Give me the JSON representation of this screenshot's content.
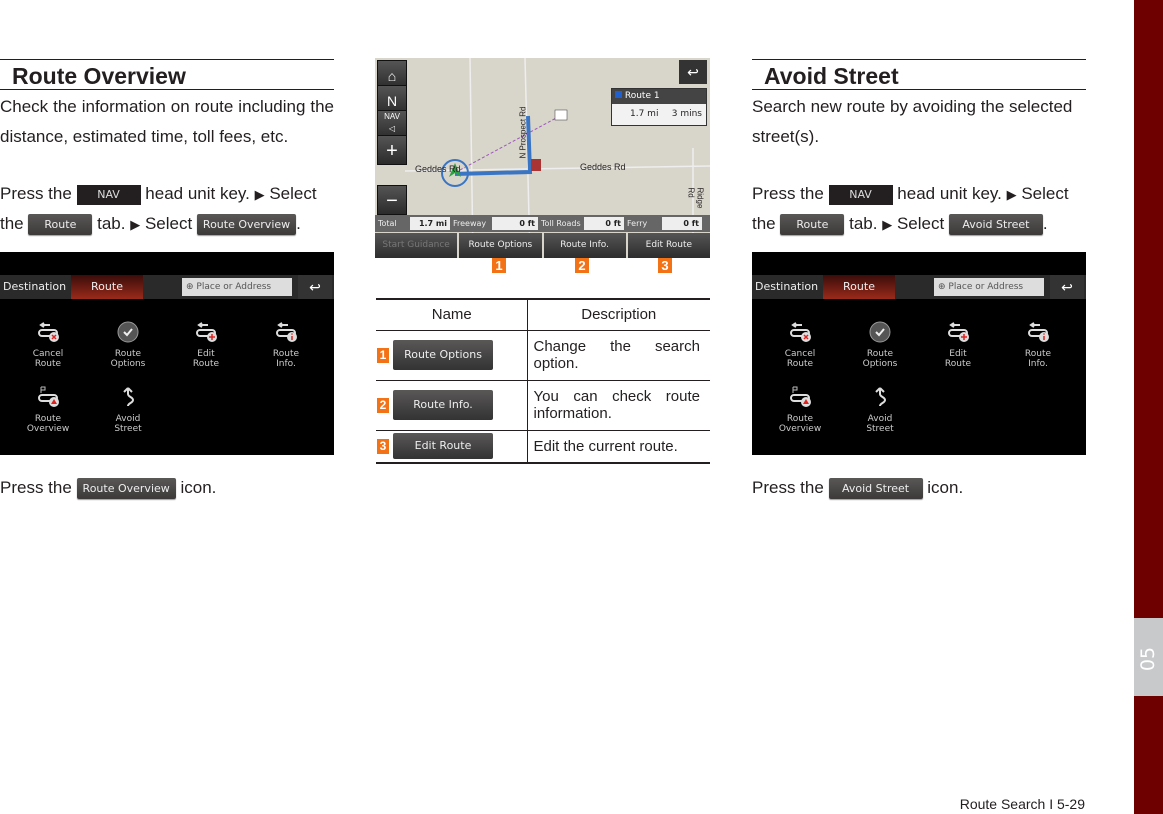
{
  "left": {
    "title": "Route Overview",
    "description": "Check the information on route including the distance, estimated time, toll fees, etc.",
    "step1_a": "Press the",
    "nav_key": "NAV",
    "step1_b": "head unit key.",
    "arrow": "▶",
    "step1_c": "Select",
    "step2_a": "the",
    "route_tab": "Route",
    "step2_b": "tab.",
    "step2_c": "Select",
    "select_button": "Route Overview",
    "press_a": "Press the",
    "press_button": "Route Overview",
    "press_b": "icon."
  },
  "right": {
    "title": "Avoid Street",
    "description": "Search new route by avoiding the selected street(s).",
    "step1_a": "Press the",
    "nav_key": "NAV",
    "step1_b": "head unit key.",
    "arrow": "▶",
    "step1_c": "Select",
    "step2_a": "the",
    "route_tab": "Route",
    "step2_b": "tab.",
    "step2_c": "Select",
    "select_button": "Avoid Street",
    "press_a": "Press the",
    "press_button": "Avoid Street",
    "press_b": "icon."
  },
  "headunit": {
    "tab_destination": "Destination",
    "tab_route": "Route",
    "search_placeholder": "Place or Address",
    "back": "↩",
    "items": [
      {
        "line1": "Cancel",
        "line2": "Route",
        "icon": "cancel-route-icon"
      },
      {
        "line1": "Route",
        "line2": "Options",
        "icon": "route-options-icon"
      },
      {
        "line1": "Edit",
        "line2": "Route",
        "icon": "edit-route-icon"
      },
      {
        "line1": "Route",
        "line2": "Info.",
        "icon": "route-info-icon"
      },
      {
        "line1": "Route",
        "line2": "Overview",
        "icon": "route-overview-icon"
      },
      {
        "line1": "Avoid",
        "line2": "Street",
        "icon": "avoid-street-icon"
      }
    ],
    "accent": "#9a2a1a"
  },
  "map": {
    "home": "⌂",
    "north": "N",
    "nav_vol": "NAV",
    "zoom_in": "+",
    "zoom_out": "−",
    "back": "↩",
    "route_name": "Route 1",
    "route_distance": "1.7 mi",
    "route_time": "3 mins",
    "streets": [
      "Geddes Rd",
      "Geddes Rd",
      "N Prospect Rd",
      "Ridge Rd"
    ],
    "stats": [
      {
        "label": "Total",
        "value": "1.7 mi"
      },
      {
        "label": "Freeway",
        "value": "0 ft"
      },
      {
        "label": "Toll Roads",
        "value": "0 ft"
      },
      {
        "label": "Ferry",
        "value": "0 ft"
      }
    ],
    "actions": [
      "Start Guidance",
      "Route Options",
      "Route Info.",
      "Edit Route"
    ],
    "markers": [
      "1",
      "2",
      "3"
    ]
  },
  "table": {
    "headers": [
      "Name",
      "Description"
    ],
    "rows": [
      {
        "num": "1",
        "button": "Route Options",
        "description": "Change the search option."
      },
      {
        "num": "2",
        "button": "Route Info.",
        "description": "You can check route information."
      },
      {
        "num": "3",
        "button": "Edit Route",
        "description": "Edit the current route."
      }
    ]
  },
  "sidebar": {
    "chapter": "05",
    "color": "#6f0000"
  },
  "footer": {
    "page": "Route Search I 5-29"
  }
}
